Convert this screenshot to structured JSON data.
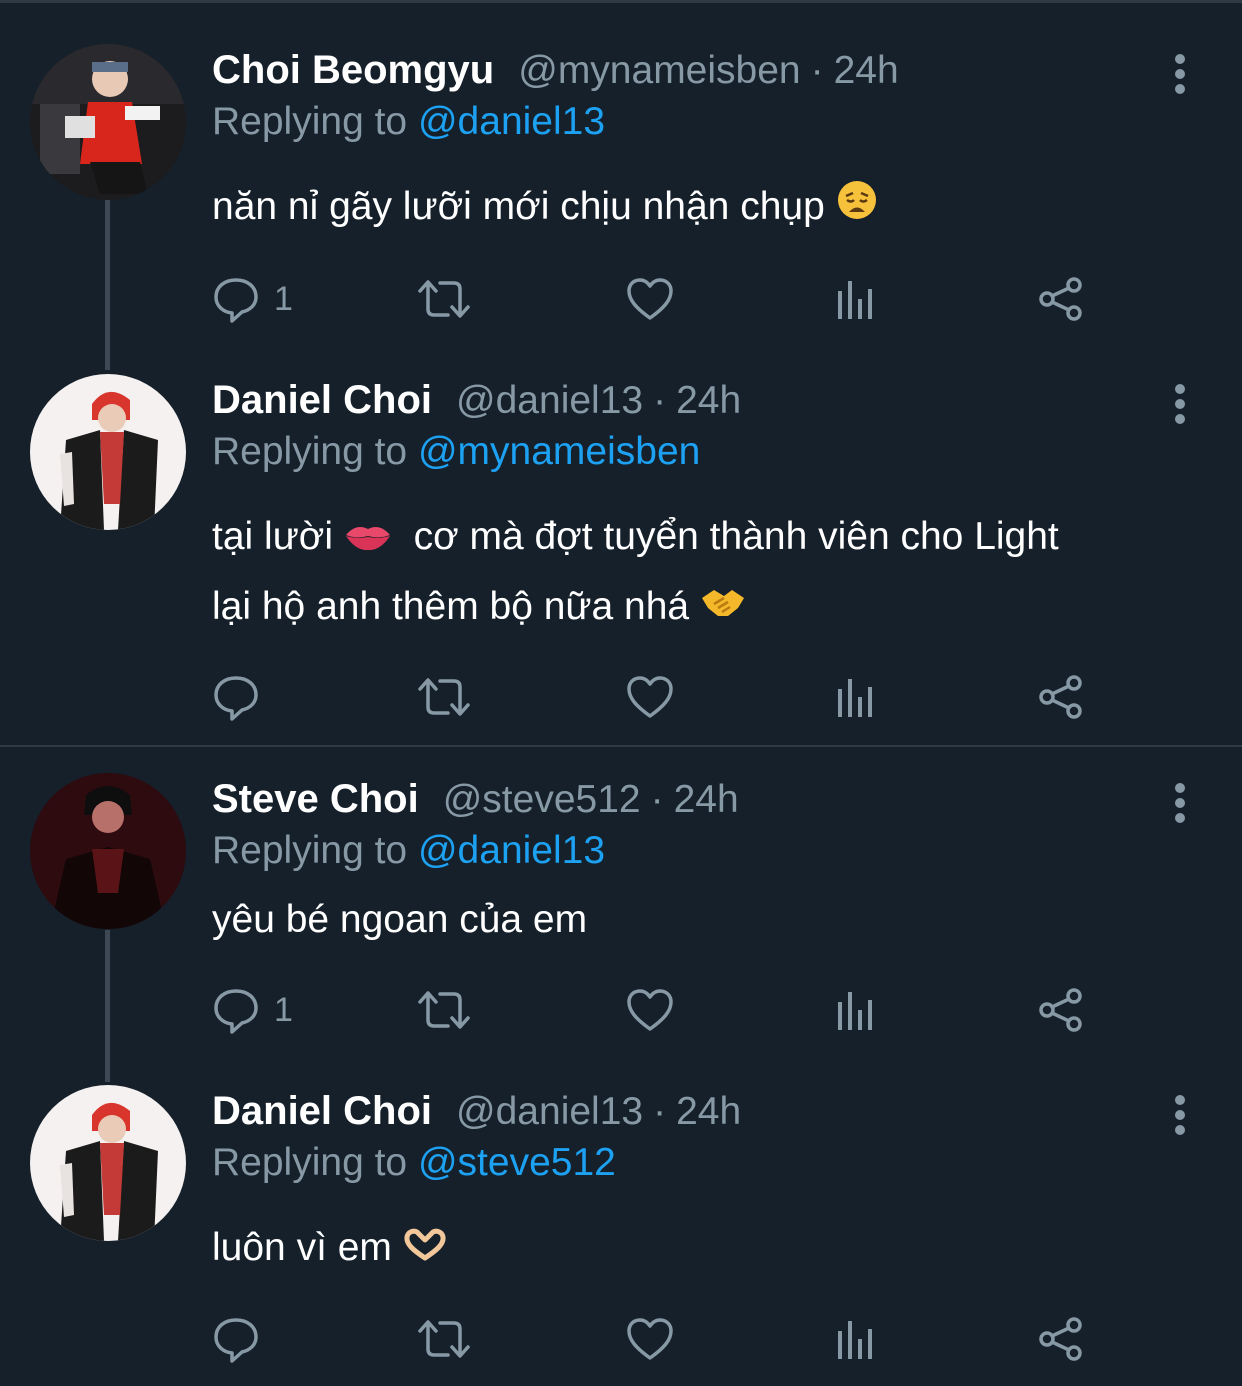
{
  "tweets": [
    {
      "name": "Choi Beomgyu",
      "handle": "@mynameisben",
      "separator_dot": "·",
      "time": "24h",
      "replying_prefix": "Replying to",
      "replying_to": "@daniel13",
      "text": "năn nỉ gãy lưỡi mới chịu nhận chụp",
      "emoji": "weary-face",
      "reply_count": "1",
      "avatar_style": "red-jacket"
    },
    {
      "name": "Daniel Choi",
      "handle": "@daniel13",
      "separator_dot": "·",
      "time": "24h",
      "replying_prefix": "Replying to",
      "replying_to": "@mynameisben",
      "text_line1a": "tại lười",
      "text_line1b": "cơ mà đợt tuyển thành viên cho Light",
      "text_line2": "lại hộ anh thêm bộ nữa nhá",
      "emoji1": "lips",
      "emoji2": "handshake",
      "reply_count": "",
      "avatar_style": "red-hair-vest"
    },
    {
      "name": "Steve Choi",
      "handle": "@steve512",
      "separator_dot": "·",
      "time": "24h",
      "replying_prefix": "Replying to",
      "replying_to": "@daniel13",
      "text": "yêu bé ngoan của em",
      "reply_count": "1",
      "avatar_style": "dark-red"
    },
    {
      "name": "Daniel Choi",
      "handle": "@daniel13",
      "separator_dot": "·",
      "time": "24h",
      "replying_prefix": "Replying to",
      "replying_to": "@steve512",
      "text": "luôn vì em",
      "emoji": "heart-hands",
      "reply_count": "",
      "avatar_style": "red-hair-vest"
    }
  ],
  "colors": {
    "background": "#15202b",
    "muted": "#8899a6",
    "accent": "#1da1f2",
    "divider": "#2f3a45"
  },
  "icons": [
    "reply-icon",
    "retweet-icon",
    "like-icon",
    "analytics-icon",
    "share-icon",
    "more-icon"
  ]
}
